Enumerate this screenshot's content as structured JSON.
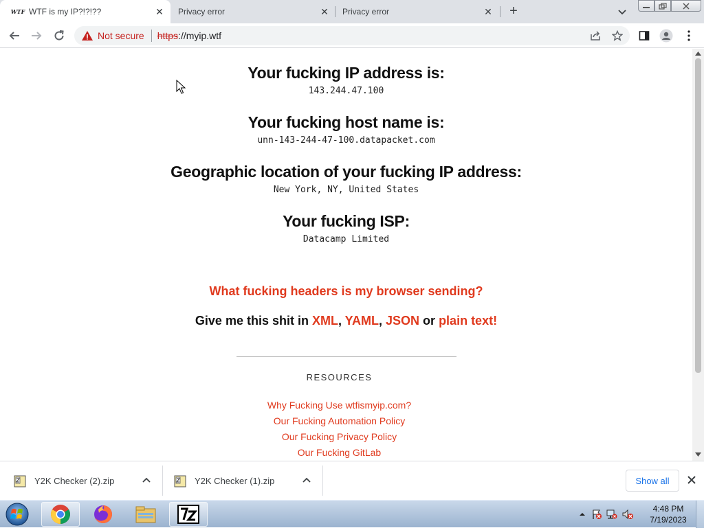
{
  "tabs": [
    {
      "favicon": "WTF",
      "title": "WTF is my IP?!?!??",
      "active": true
    },
    {
      "title": "Privacy error",
      "active": false
    },
    {
      "title": "Privacy error",
      "active": false
    }
  ],
  "toolbar": {
    "security_text": "Not secure",
    "url_scheme": "https",
    "url_rest": "://myip.wtf"
  },
  "page": {
    "ip_heading": "Your fucking IP address is:",
    "ip_value": "143.244.47.100",
    "host_heading": "Your fucking host name is:",
    "host_value": "unn-143-244-47-100.datapacket.com",
    "geo_heading": "Geographic location of your fucking IP address:",
    "geo_value": "New York, NY, United States",
    "isp_heading": "Your fucking ISP:",
    "isp_value": "Datacamp Limited",
    "headers_link": "What fucking headers is my browser sending?",
    "giveme_prefix": "Give me this shit in ",
    "format_xml": "XML",
    "sep1": ", ",
    "format_yaml": "YAML",
    "sep2": ", ",
    "format_json": "JSON",
    "or_text": " or ",
    "format_plain": "plain text!",
    "resources_heading": "RESOURCES",
    "resource_links": [
      "Why Fucking Use wtfismyip.com?",
      "Our Fucking Automation Policy",
      "Our Fucking Privacy Policy",
      "Our Fucking GitLab"
    ]
  },
  "downloads": {
    "items": [
      "Y2K Checker (2).zip",
      "Y2K Checker (1).zip"
    ],
    "show_all": "Show all"
  },
  "taskbar": {
    "pinned": [
      "chrome-icon",
      "firefox-icon",
      "file-explorer-icon",
      "7zip-icon"
    ],
    "time": "4:48 PM",
    "date": "7/19/2023"
  },
  "colors": {
    "link_red": "#e03a1e",
    "not_secure_red": "#c5221f",
    "show_all_blue": "#1a73e8"
  }
}
